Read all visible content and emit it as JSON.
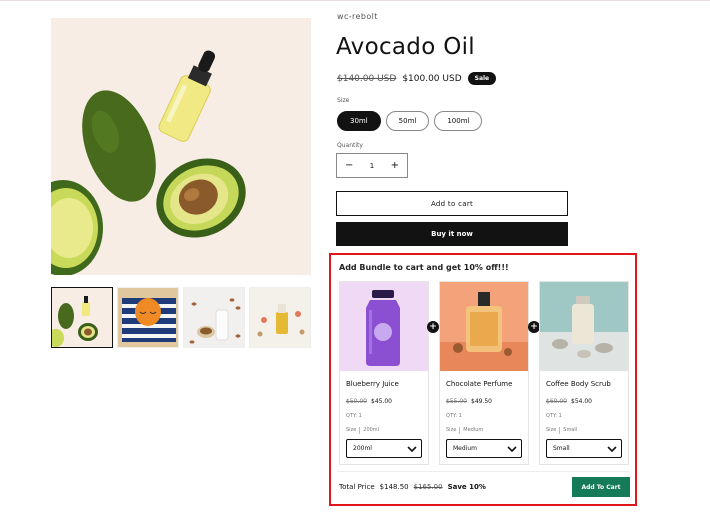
{
  "product": {
    "vendor": "wc-rebolt",
    "title": "Avocado Oil",
    "compare_price": "$140.00 USD",
    "price": "$100.00 USD",
    "badge": "Sale",
    "size_label": "Size",
    "sizes": [
      "30ml",
      "50ml",
      "100ml"
    ],
    "selected_size": "30ml",
    "quantity_label": "Quantity",
    "quantity": "1",
    "add_to_cart": "Add to cart",
    "buy_now": "Buy it now"
  },
  "bundle": {
    "title": "Add Bundle to cart and get 10% off!!!",
    "items": [
      {
        "name": "Blueberry Juice",
        "old": "$50.00",
        "price": "$45.00",
        "qty": "QTY: 1",
        "size_key": "Size",
        "size_val": "200ml",
        "select": "200ml"
      },
      {
        "name": "Chocolate Perfume",
        "old": "$55.00",
        "price": "$49.50",
        "qty": "QTY: 1",
        "size_key": "Size",
        "size_val": "Medium",
        "select": "Medium"
      },
      {
        "name": "Coffee Body Scrub",
        "old": "$60.00",
        "price": "$54.00",
        "qty": "QTY: 1",
        "size_key": "Size",
        "size_val": "Small",
        "select": "Small"
      }
    ],
    "total_label": "Total Price",
    "total_price": "$148.50",
    "total_old": "$165.00",
    "save": "Save 10%",
    "button": "Add To Cart"
  },
  "colors": {
    "accent": "#121212",
    "bundle_border": "#e0161b",
    "bundle_button": "#157a58"
  }
}
